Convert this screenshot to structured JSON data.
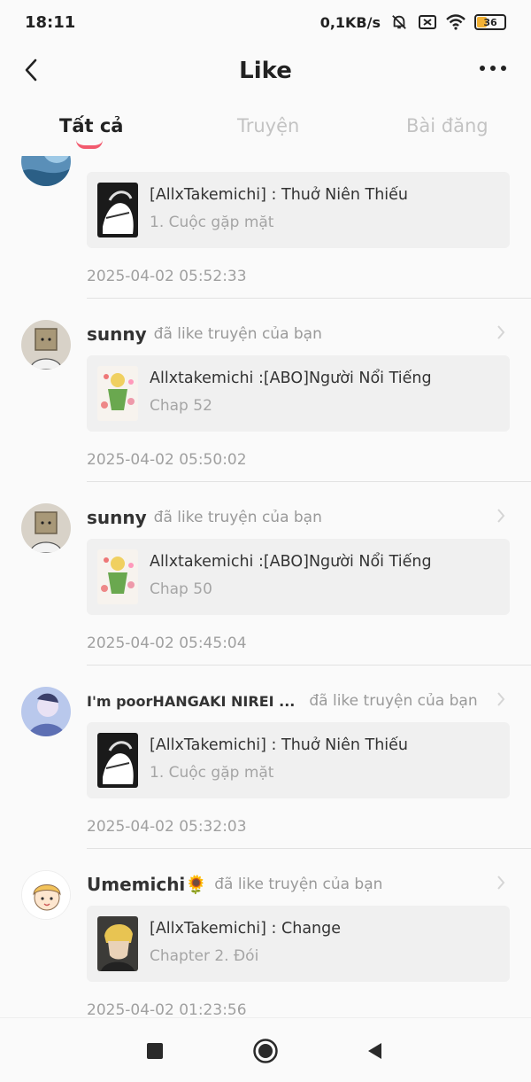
{
  "status_bar": {
    "time": "18:11",
    "net_speed": "0,1KB/s",
    "battery": "36"
  },
  "header": {
    "title": "Like"
  },
  "tabs": [
    {
      "label": "Tất cả",
      "active": true
    },
    {
      "label": "Truyện",
      "active": false
    },
    {
      "label": "Bài đăng",
      "active": false
    }
  ],
  "notifications": [
    {
      "user": "",
      "action": "",
      "comic_title": "[AllxTakemichi] : Thuở Niên Thiếu",
      "chapter": "1. Cuộc gặp mặt",
      "time": "2025-04-02 05:52:33"
    },
    {
      "user": "sunny",
      "action": "đã like truyện của bạn",
      "comic_title": "Allxtakemichi :[ABO]Người Nổi Tiếng",
      "chapter": "Chap 52",
      "time": "2025-04-02 05:50:02"
    },
    {
      "user": "sunny",
      "action": "đã like truyện của bạn",
      "comic_title": "Allxtakemichi :[ABO]Người Nổi Tiếng",
      "chapter": "Chap 50",
      "time": "2025-04-02 05:45:04"
    },
    {
      "user": "I'm poorHANGAKI NIREI ...",
      "action": "đã like truyện của bạn",
      "comic_title": "[AllxTakemichi] : Thuở Niên Thiếu",
      "chapter": "1. Cuộc gặp mặt",
      "time": "2025-04-02 05:32:03"
    },
    {
      "user": "Umemichi🌻",
      "action": "đã like truyện của bạn",
      "comic_title": "[AllxTakemichi] : Change",
      "chapter": "Chapter 2. Đói",
      "time": "2025-04-02 01:23:56"
    }
  ],
  "icons": {
    "back": "chevron-left-icon",
    "more": "more-horizontal-icon",
    "nav_recent": "square-icon",
    "nav_home": "circle-icon",
    "nav_back": "triangle-left-icon"
  },
  "colors": {
    "accent": "#f25a6e",
    "background": "#fafafa",
    "card": "#f0f0f0"
  }
}
